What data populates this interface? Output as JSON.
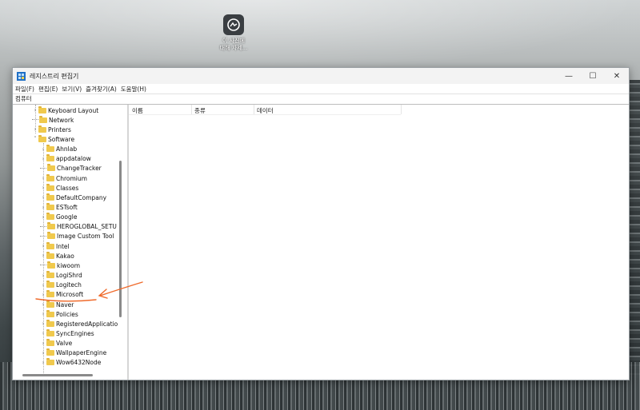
{
  "desktop": {
    "icon_label_line1": "이 사진에",
    "icon_label_line2": "대해 자세..."
  },
  "window": {
    "title": "레지스트리 편집기",
    "controls": {
      "minimize": "—",
      "maximize": "☐",
      "close": "✕"
    }
  },
  "menu": [
    "파일(F)",
    "편집(E)",
    "보기(V)",
    "즐겨찾기(A)",
    "도움말(H)"
  ],
  "address": "컴퓨터",
  "tree": {
    "items": [
      {
        "label": "Keyboard Layout",
        "indent": 1,
        "chevron": ">"
      },
      {
        "label": "Network",
        "indent": 1,
        "chevron": ""
      },
      {
        "label": "Printers",
        "indent": 1,
        "chevron": ">"
      },
      {
        "label": "Software",
        "indent": 1,
        "chevron": "v"
      },
      {
        "label": "Ahnlab",
        "indent": 2,
        "chevron": ">"
      },
      {
        "label": "appdatalow",
        "indent": 2,
        "chevron": ">"
      },
      {
        "label": "ChangeTracker",
        "indent": 2,
        "chevron": ""
      },
      {
        "label": "Chromium",
        "indent": 2,
        "chevron": ">"
      },
      {
        "label": "Classes",
        "indent": 2,
        "chevron": ">"
      },
      {
        "label": "DefaultCompany",
        "indent": 2,
        "chevron": ">"
      },
      {
        "label": "ESTsoft",
        "indent": 2,
        "chevron": ">"
      },
      {
        "label": "Google",
        "indent": 2,
        "chevron": ">"
      },
      {
        "label": "HEROGLOBAL_SETU",
        "indent": 2,
        "chevron": ""
      },
      {
        "label": "Image Custom Tool",
        "indent": 2,
        "chevron": ""
      },
      {
        "label": "Intel",
        "indent": 2,
        "chevron": ">"
      },
      {
        "label": "Kakao",
        "indent": 2,
        "chevron": ">"
      },
      {
        "label": "kiwoom",
        "indent": 2,
        "chevron": ""
      },
      {
        "label": "LogiShrd",
        "indent": 2,
        "chevron": ">"
      },
      {
        "label": "Logitech",
        "indent": 2,
        "chevron": ">"
      },
      {
        "label": "Microsoft",
        "indent": 2,
        "chevron": ">"
      },
      {
        "label": "Naver",
        "indent": 2,
        "chevron": ">"
      },
      {
        "label": "Policies",
        "indent": 2,
        "chevron": ">"
      },
      {
        "label": "RegisteredApplicatio",
        "indent": 2,
        "chevron": ">"
      },
      {
        "label": "SyncEngines",
        "indent": 2,
        "chevron": ">"
      },
      {
        "label": "Valve",
        "indent": 2,
        "chevron": ">"
      },
      {
        "label": "WallpaperEngine",
        "indent": 2,
        "chevron": ">"
      },
      {
        "label": "Wow6432Node",
        "indent": 2,
        "chevron": ">"
      }
    ]
  },
  "list": {
    "columns": [
      "이름",
      "종류",
      "데이터"
    ]
  },
  "colors": {
    "folder": "#f0c94d",
    "annotation": "#ef6a2b"
  }
}
